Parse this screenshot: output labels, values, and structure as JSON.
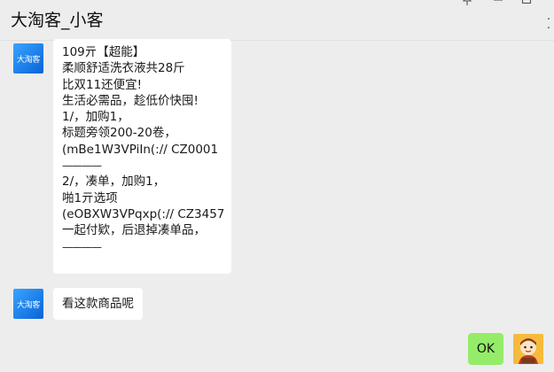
{
  "window": {
    "title": "大淘客_小客",
    "pin_icon": "pin-icon",
    "minimize_icon": "minimize-icon",
    "maximize_icon": "maximize-icon",
    "more_icon": "more-icon"
  },
  "messages": [
    {
      "sender": "received",
      "avatar_text": "大淘客",
      "lines": [
        "109亓【超能】",
        "柔顺舒适洗衣液共28斤",
        "比双11还便宜!",
        "生活必需品，趁低价快囤!",
        "1/，加购1，",
        "标题旁领200-20卷，",
        "(mBe1W3VPiIn(:// CZ0001",
        "————",
        "2/，凑单，加购1，",
        "啪1亓选项",
        "(eOBXW3VPqxp(:// CZ3457",
        "一起付欵，后退掉凑单品，",
        "————"
      ]
    },
    {
      "sender": "received",
      "avatar_text": "大淘客",
      "text": "看这款商品呢"
    },
    {
      "sender": "me",
      "text": "OK"
    }
  ],
  "colors": {
    "background": "#ededed",
    "bubble_received": "#ffffff",
    "bubble_sent": "#95ec69",
    "avatar_brand": "#1677e6"
  }
}
